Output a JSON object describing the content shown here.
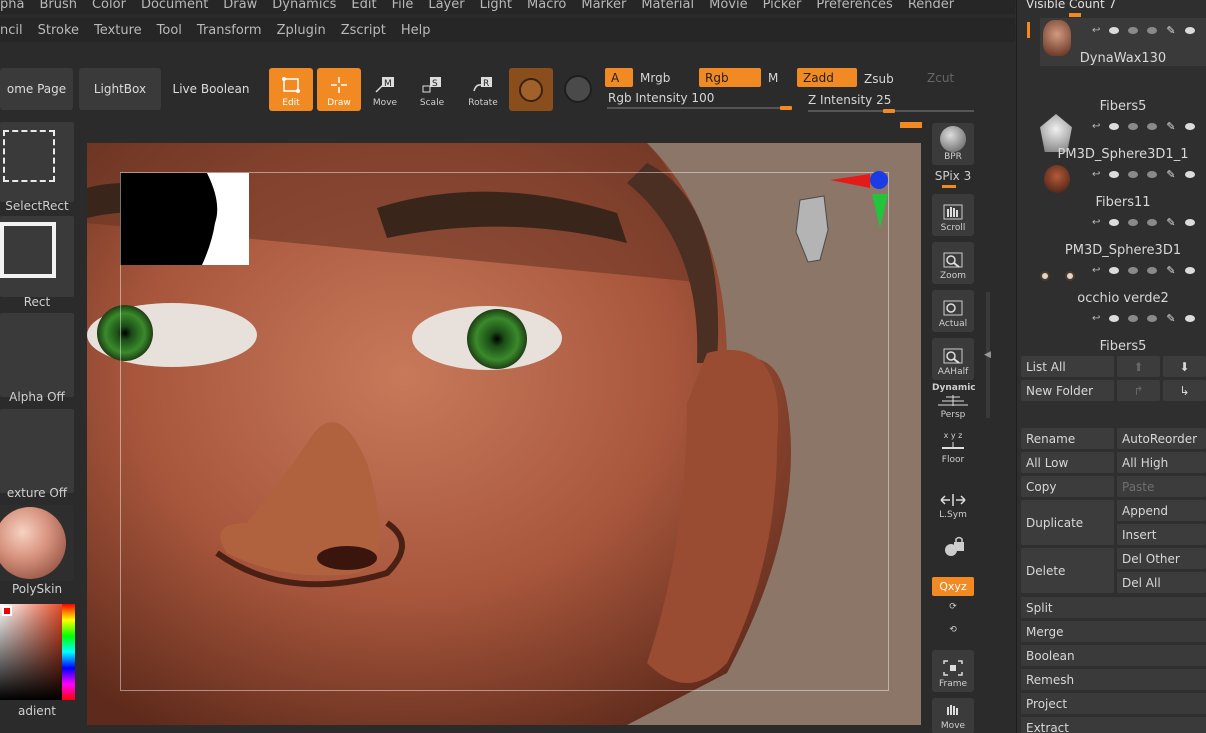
{
  "menu_top": [
    "pha",
    "Brush",
    "Color",
    "Document",
    "Draw",
    "Dynamics",
    "Edit",
    "File",
    "Layer",
    "Light",
    "Macro",
    "Marker",
    "Material",
    "Movie",
    "Picker",
    "Preferences",
    "Render"
  ],
  "menu_second": [
    "ncil",
    "Stroke",
    "Texture",
    "Tool",
    "Transform",
    "Zplugin",
    "Zscript",
    "Help"
  ],
  "nav": {
    "home_page": "ome Page",
    "lightbox": "LightBox",
    "live_boolean": "Live Boolean"
  },
  "tools": {
    "edit": "Edit",
    "draw": "Draw",
    "move": "Move",
    "scale": "Scale",
    "rotate": "Rotate"
  },
  "color_mode": {
    "a": "A",
    "mrgb": "Mrgb",
    "rgb": "Rgb",
    "m": "M",
    "zadd": "Zadd",
    "zsub": "Zsub",
    "zcut": "Zcut",
    "rgb_intensity_label": "Rgb Intensity 100",
    "z_intensity_label": "Z Intensity 25",
    "rgb_intensity": 100,
    "z_intensity": 25
  },
  "left_shelf": {
    "select_rect": "SelectRect",
    "rect": "Rect",
    "alpha_off": "Alpha Off",
    "texture_off": "exture Off",
    "poly_skin": "PolySkin",
    "gradient": "adient"
  },
  "right_strip": {
    "bpr": "BPR",
    "spix": "SPix 3",
    "scroll": "Scroll",
    "zoom": "Zoom",
    "actual": "Actual",
    "aahalf": "AAHalf",
    "dynamic": "Dynamic",
    "persp": "Persp",
    "xyz_small": "x y z",
    "floor": "Floor",
    "lsym": "L.Sym",
    "xyz": "Qxyz",
    "frame": "Frame",
    "move": "Move"
  },
  "subtool": {
    "visible_count": "Visible Count 7",
    "items": [
      "DynaWax130",
      "Fibers5",
      "PM3D_Sphere3D1_1",
      "Fibers11",
      "PM3D_Sphere3D1",
      "occhio verde2",
      "Fibers5"
    ],
    "list_all": "List All",
    "new_folder": "New Folder",
    "rename": "Rename",
    "auto_reorder": "AutoReorder",
    "all_low": "All Low",
    "all_high": "All High",
    "copy": "Copy",
    "paste": "Paste",
    "duplicate": "Duplicate",
    "append": "Append",
    "insert": "Insert",
    "delete": "Delete",
    "del_other": "Del Other",
    "del_all": "Del All",
    "split": "Split",
    "merge": "Merge",
    "boolean": "Boolean",
    "remesh": "Remesh",
    "project": "Project",
    "extract": "Extract"
  },
  "colors": {
    "accent": "#f28a24",
    "panel": "#2b2b2b",
    "button": "#3a3a3a"
  }
}
